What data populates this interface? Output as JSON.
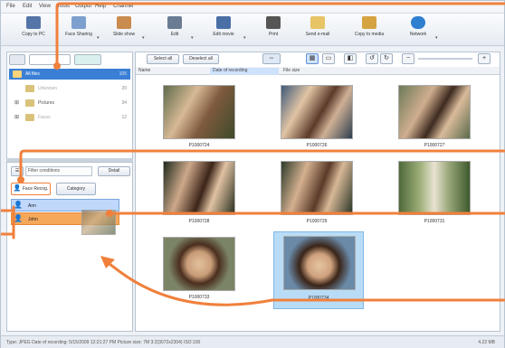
{
  "menubar": {
    "items": [
      "File",
      "Edit",
      "View",
      "Tools",
      "Output",
      "Help",
      "Channel"
    ]
  },
  "toolbar": {
    "tools": [
      {
        "label": "Copy to PC",
        "icon": "camera-to-pc-icon"
      },
      {
        "label": "Face Sharing",
        "icon": "face-share-icon"
      },
      {
        "label": "Slide show",
        "icon": "slideshow-icon"
      },
      {
        "label": "Edit",
        "icon": "edit-icon"
      },
      {
        "label": "Edit movie",
        "icon": "edit-movie-icon"
      },
      {
        "label": "Print",
        "icon": "print-icon"
      },
      {
        "label": "Send e-mail",
        "icon": "email-icon"
      },
      {
        "label": "Copy to media",
        "icon": "copy-media-icon"
      },
      {
        "label": "Network",
        "icon": "network-icon"
      }
    ]
  },
  "left": {
    "tree": [
      {
        "label": "All files",
        "count": "105"
      },
      {
        "label": "Unknown",
        "count": "20"
      },
      {
        "label": "Pictures",
        "count": "34"
      },
      {
        "label": "Faces",
        "count": "12"
      }
    ],
    "lower": {
      "filter_label": "Filter conditions",
      "detail_label": "Detail",
      "tabs": [
        "Face Recog.",
        "Category"
      ],
      "people": [
        {
          "name": "Ann"
        },
        {
          "name": "John"
        }
      ]
    }
  },
  "right": {
    "toolbar": {
      "select_all": "Select all",
      "deselect_all": "Deselect all"
    },
    "columns": [
      "Name",
      "Date of recording",
      "File size"
    ],
    "thumbs": [
      {
        "caption": "P1000724"
      },
      {
        "caption": "P1000726"
      },
      {
        "caption": "P1000727"
      },
      {
        "caption": "P1000728"
      },
      {
        "caption": "P1000729"
      },
      {
        "caption": "P1000731"
      },
      {
        "caption": "P1000733"
      },
      {
        "caption": "P1000734"
      }
    ]
  },
  "status": {
    "text": "Type: JPEG  Date of recording: 5/15/2009 12:21:27 PM  Picture size: 7M 3:2(3072x2304)  ISO:100",
    "size": "4.22 MB"
  },
  "colors": {
    "accent": "#f0803c",
    "selection": "#3a7fd5",
    "highlight_orange": "#f5a85a"
  }
}
